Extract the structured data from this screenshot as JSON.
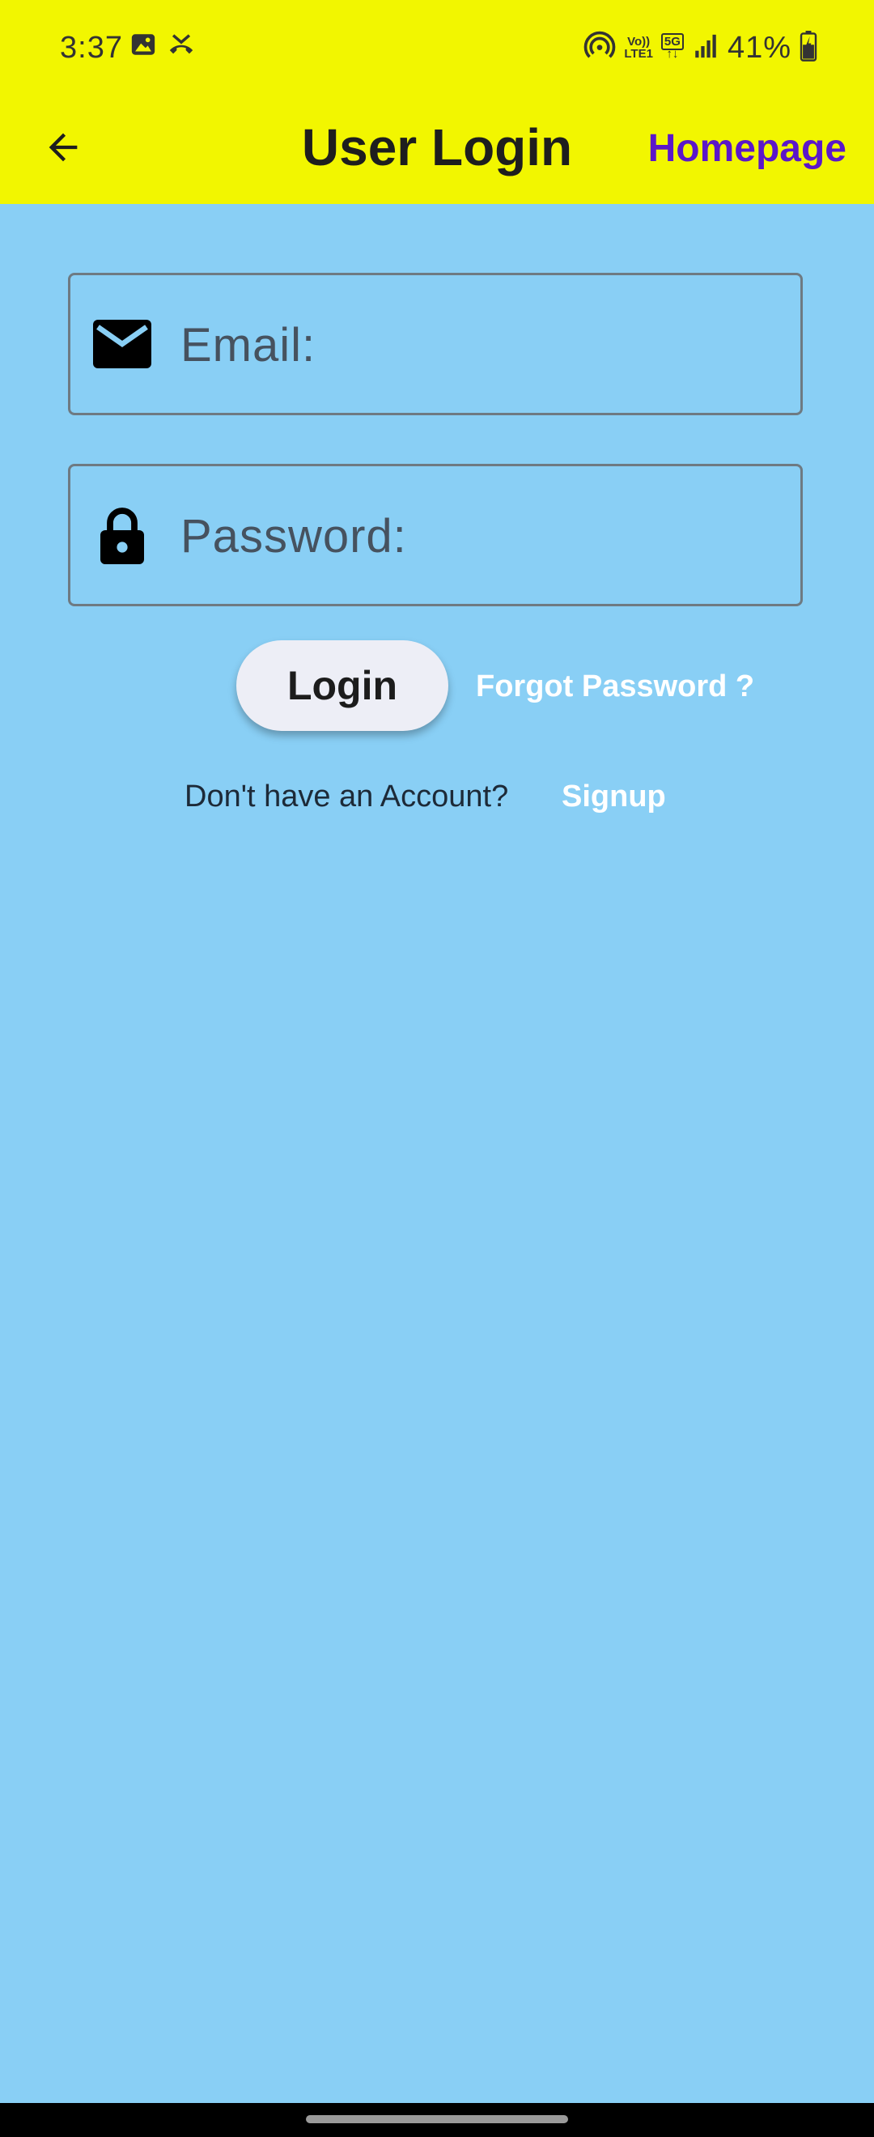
{
  "status_bar": {
    "time": "3:37",
    "battery_percent": "41%",
    "network_top": "Vo))",
    "network_bottom": "LTE1",
    "network_5g": "5G",
    "left_icons": [
      "gallery-icon",
      "missed-call-icon"
    ],
    "right_icons": [
      "hotspot-icon",
      "signal-icon",
      "battery-icon"
    ]
  },
  "app_bar": {
    "title": "User Login",
    "homepage_label": "Homepage",
    "back_icon": "arrow-left-icon"
  },
  "form": {
    "email": {
      "placeholder": "Email:",
      "value": "",
      "icon": "mail-icon"
    },
    "password": {
      "placeholder": "Password:",
      "value": "",
      "icon": "lock-icon"
    },
    "login_label": "Login",
    "forgot_label": "Forgot Password ?",
    "no_account_text": "Don't have an Account?",
    "signup_label": "Signup"
  },
  "colors": {
    "app_bar_bg": "#F2F600",
    "body_bg": "#89CFF5",
    "homepage_link": "#5B17C9",
    "button_bg": "#EDEEF6",
    "link_text": "#FFFFFF"
  }
}
